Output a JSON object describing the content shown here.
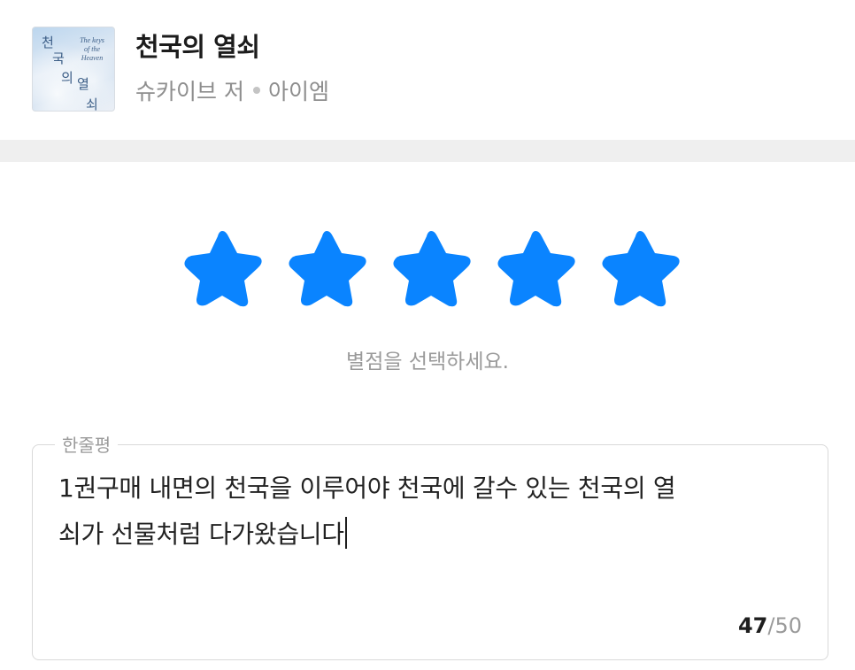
{
  "book": {
    "title": "천국의 열쇠",
    "author": "슈카이브 저",
    "publisher": "아이엠",
    "cover": {
      "title_chars": [
        "천",
        "국",
        "의",
        "열",
        "쇠"
      ],
      "english_lines": [
        "The keys",
        "of the",
        "Heaven"
      ]
    }
  },
  "rating": {
    "value": 5,
    "max": 5,
    "hint": "별점을 선택하세요.",
    "star_color": "#0A84FF",
    "stars": [
      {
        "label": "1"
      },
      {
        "label": "2"
      },
      {
        "label": "3"
      },
      {
        "label": "4"
      },
      {
        "label": "5"
      }
    ]
  },
  "review": {
    "label": "한줄평",
    "text_line1": "1권구매 내면의 천국을 이루어야 천국에 갈수 있는 천국의 열",
    "text_line2": "쇠가 선물처럼 다가왔습니다",
    "char_count": "47",
    "char_limit": "/50"
  }
}
